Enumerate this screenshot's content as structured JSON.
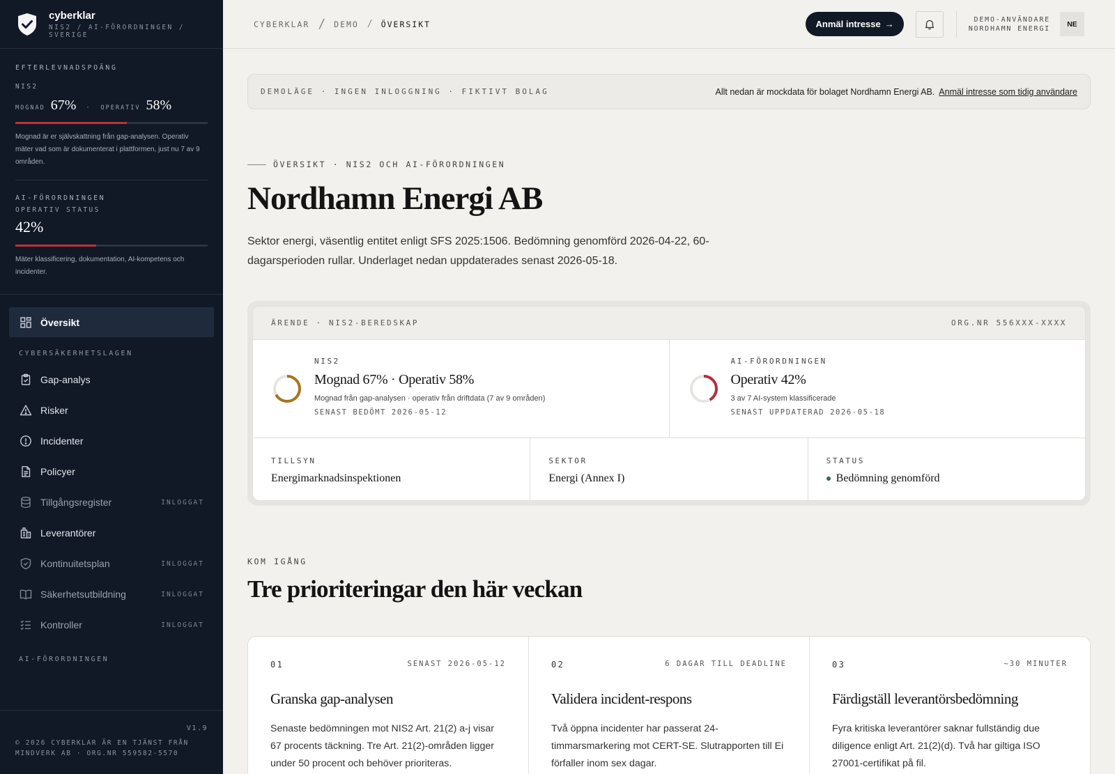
{
  "brand": {
    "name": "cyberklar",
    "sub": "NIS2 / AI-FÖRORDNINGEN / SVERIGE"
  },
  "sidebar": {
    "scores_label": "EFTERLEVNADSPOÄNG",
    "nis2": {
      "label": "NIS2",
      "mognad_key": "MOGNAD",
      "mognad_val": "67%",
      "sep": "·",
      "operativ_key": "OPERATIV",
      "operativ_val": "58%",
      "progress": 0.58,
      "note": "Mognad är er självskattning från gap-analysen. Operativ mäter vad som är dokumenterat i plattformen, just nu 7 av 9 områden."
    },
    "ai": {
      "label": "AI-FÖRORDNINGEN",
      "sub": "OPERATIV STATUS",
      "val": "42%",
      "progress": 0.42,
      "note": "Mäter klassificering, dokumentation, AI-kompetens och incidenter."
    },
    "nav_active": {
      "label": "Översikt",
      "icon": "grid-icon"
    },
    "section1": "CYBERSÄKERHETSLAGEN",
    "items": [
      {
        "label": "Gap-analys",
        "icon": "clipboard-icon",
        "tag": ""
      },
      {
        "label": "Risker",
        "icon": "warning-icon",
        "tag": ""
      },
      {
        "label": "Incidenter",
        "icon": "alert-circle-icon",
        "tag": ""
      },
      {
        "label": "Policyer",
        "icon": "document-icon",
        "tag": ""
      },
      {
        "label": "Tillgångsregister",
        "icon": "database-icon",
        "tag": "INLOGGAT"
      },
      {
        "label": "Leverantörer",
        "icon": "building-icon",
        "tag": ""
      },
      {
        "label": "Kontinuitetsplan",
        "icon": "shield-check-icon",
        "tag": "INLOGGAT"
      },
      {
        "label": "Säkerhetsutbildning",
        "icon": "book-icon",
        "tag": "INLOGGAT"
      },
      {
        "label": "Kontroller",
        "icon": "checklist-icon",
        "tag": "INLOGGAT"
      }
    ],
    "section2": "AI-FÖRORDNINGEN",
    "version": "V1.9",
    "copyright": "© 2026 CYBERKLAR ÄR EN TJÄNST FRÅN MINDVERK AB · ORG.NR 559582-5570"
  },
  "topbar": {
    "crumbs": [
      "CYBERKLAR",
      "/",
      "DEMO",
      "/",
      "ÖVERSIKT"
    ],
    "cta": "Anmäl intresse",
    "cta_arrow": "→",
    "user_line1": "DEMO-ANVÄNDARE",
    "user_line2": "NORDHAMN ENERGI",
    "avatar": "NE"
  },
  "banner": {
    "left": "DEMOLÄGE · INGEN INLOGGNING · FIKTIVT BOLAG",
    "right": "Allt nedan är mockdata för bolaget Nordhamn Energi AB.",
    "link": "Anmäl intresse som tidig användare"
  },
  "overview": {
    "eyebrow": "ÖVERSIKT · NIS2 OCH AI-FÖRORDNINGEN",
    "title": "Nordhamn Energi AB",
    "lede": "Sektor energi, väsentlig entitet enligt SFS 2025:1506. Bedömning genomförd 2026-04-22, 60-dagarsperioden rullar. Underlaget nedan uppdaterades senast 2026-05-18."
  },
  "case": {
    "head_left": "ÄRENDE · NIS2-BEREDSKAP",
    "head_right": "ORG.NR 556XXX-XXXX",
    "nis2": {
      "label": "NIS2",
      "value": "Mognad 67% · Operativ 58%",
      "note": "Mognad från gap-analysen · operativ från driftdata (7 av 9 områden)",
      "date": "SENAST BEDÖMT 2026-05-12",
      "ring": 0.67,
      "color": "#a5761f"
    },
    "ai": {
      "label": "AI-FÖRORDNINGEN",
      "value": "Operativ 42%",
      "note": "3 av 7 AI-system klassificerade",
      "date": "SENAST UPPDATERAD 2026-05-18",
      "ring": 0.42,
      "color": "#b1313b"
    },
    "tillsyn": {
      "label": "TILLSYN",
      "value": "Energimarknadsinspektionen"
    },
    "sektor": {
      "label": "SEKTOR",
      "value": "Energi (Annex I)"
    },
    "status": {
      "label": "STATUS",
      "value": "Bedömning genomförd"
    }
  },
  "priorities": {
    "eyebrow": "KOM IGÅNG",
    "title": "Tre prioriteringar den här veckan",
    "cards": [
      {
        "num": "01",
        "meta": "SENAST 2026-05-12",
        "title": "Granska gap-analysen",
        "body": "Senaste bedömningen mot NIS2 Art. 21(2) a-j visar 67 procents täckning. Tre Art. 21(2)-områden ligger under 50 procent och behöver prioriteras."
      },
      {
        "num": "02",
        "meta": "6 DAGAR TILL DEADLINE",
        "title": "Validera incident-respons",
        "body": "Två öppna incidenter har passerat 24-timmarsmarkering mot CERT-SE. Slutrapporten till Ei förfaller inom sex dagar."
      },
      {
        "num": "03",
        "meta": "~30 MINUTER",
        "title": "Färdigställ leverantörsbedömning",
        "body": "Fyra kritiska leverantörer saknar fullständig due diligence enligt Art. 21(2)(d). Två har giltiga ISO 27001-certifikat på fil."
      }
    ]
  }
}
